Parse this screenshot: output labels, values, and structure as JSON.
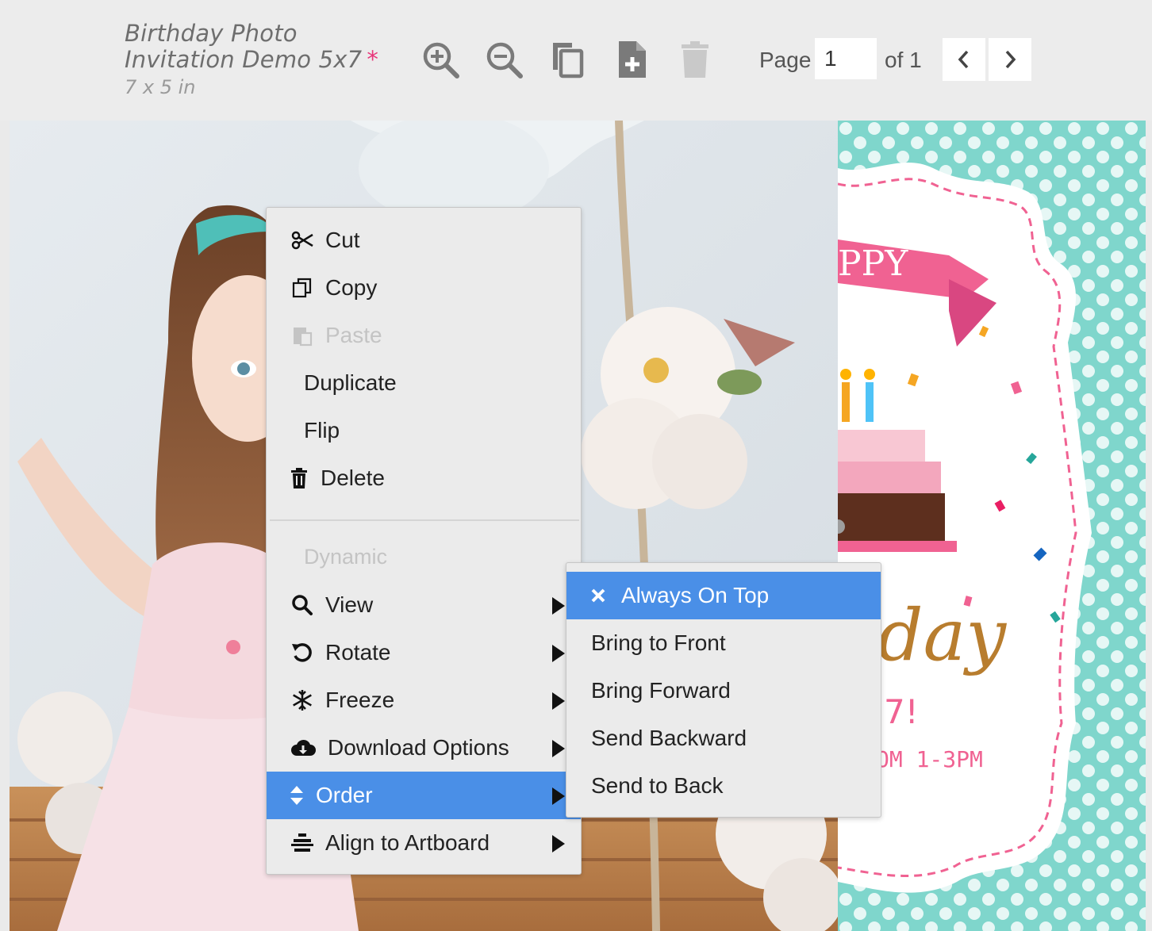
{
  "document": {
    "title_line1": "Birthday Photo",
    "title_line2": "Invitation Demo 5x7",
    "unsaved_marker": "*",
    "size": "7 x 5 in"
  },
  "toolbar": {
    "icons": [
      "zoom-in-icon",
      "zoom-out-icon",
      "copy-pages-icon",
      "add-page-icon",
      "delete-page-icon"
    ],
    "page_label": "Page",
    "page_value": "1",
    "of_label": "of 1"
  },
  "card": {
    "banner_text": "PPY",
    "script_text": "day",
    "number_text": "7!",
    "time_text": "OM 1-3PM",
    "accent_color": "#7fd6cc",
    "pink": "#f06292"
  },
  "context_menu": {
    "items": [
      {
        "label": "Cut",
        "icon": "scissors-icon"
      },
      {
        "label": "Copy",
        "icon": "copy-icon"
      },
      {
        "label": "Paste",
        "icon": "paste-icon",
        "disabled": true
      },
      {
        "label": "Duplicate"
      },
      {
        "label": "Flip"
      },
      {
        "label": "Delete",
        "icon": "trash-icon"
      }
    ],
    "section_label": "Dynamic",
    "submenus": [
      {
        "label": "View",
        "icon": "search-icon"
      },
      {
        "label": "Rotate",
        "icon": "rotate-icon"
      },
      {
        "label": "Freeze",
        "icon": "snowflake-icon"
      },
      {
        "label": "Download Options",
        "icon": "cloud-download-icon"
      },
      {
        "label": "Order",
        "icon": "sort-icon",
        "active": true
      },
      {
        "label": "Align to Artboard",
        "icon": "align-center-icon"
      }
    ]
  },
  "order_submenu": {
    "items": [
      {
        "label": "Always On Top",
        "icon": "close-icon",
        "active": true
      },
      {
        "label": "Bring to Front"
      },
      {
        "label": "Bring Forward"
      },
      {
        "label": "Send Backward"
      },
      {
        "label": "Send to Back"
      }
    ]
  },
  "colors": {
    "highlight": "#4a8fe7",
    "menu_bg": "#ebebeb",
    "toolbar_bg": "#ececec"
  }
}
